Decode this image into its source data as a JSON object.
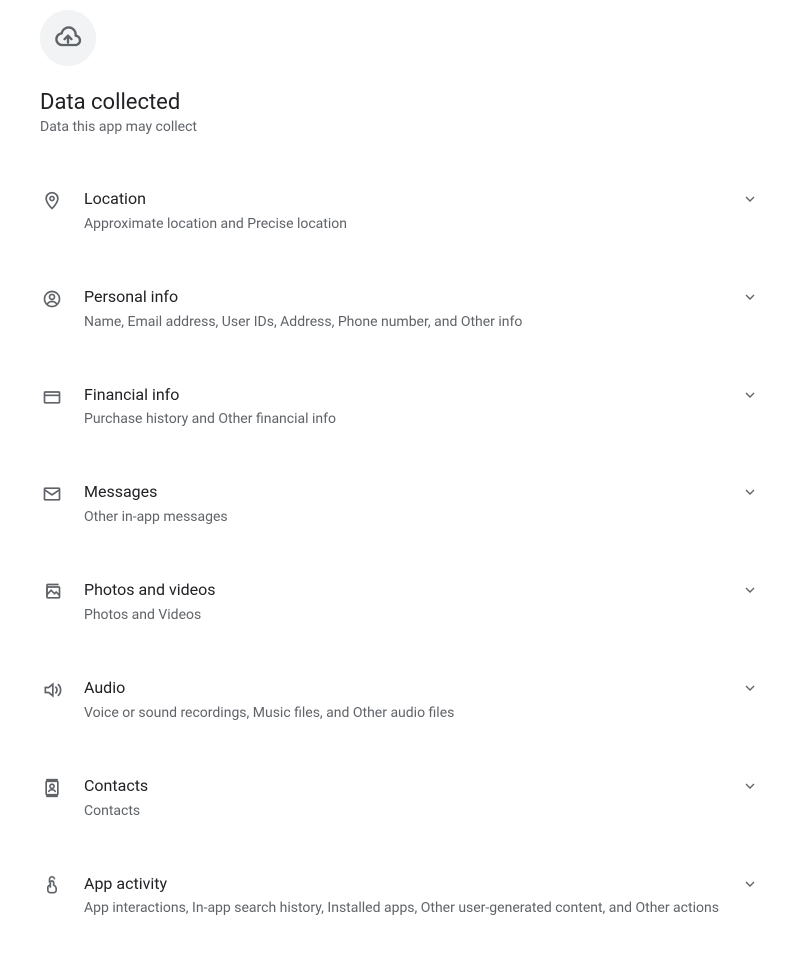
{
  "header": {
    "title": "Data collected",
    "subtitle": "Data this app may collect"
  },
  "items": [
    {
      "title": "Location",
      "description": "Approximate location and Precise location"
    },
    {
      "title": "Personal info",
      "description": "Name, Email address, User IDs, Address, Phone number, and Other info"
    },
    {
      "title": "Financial info",
      "description": "Purchase history and Other financial info"
    },
    {
      "title": "Messages",
      "description": "Other in-app messages"
    },
    {
      "title": "Photos and videos",
      "description": "Photos and Videos"
    },
    {
      "title": "Audio",
      "description": "Voice or sound recordings, Music files, and Other audio files"
    },
    {
      "title": "Contacts",
      "description": "Contacts"
    },
    {
      "title": "App activity",
      "description": "App interactions, In-app search history, Installed apps, Other user-generated content, and Other actions"
    }
  ]
}
